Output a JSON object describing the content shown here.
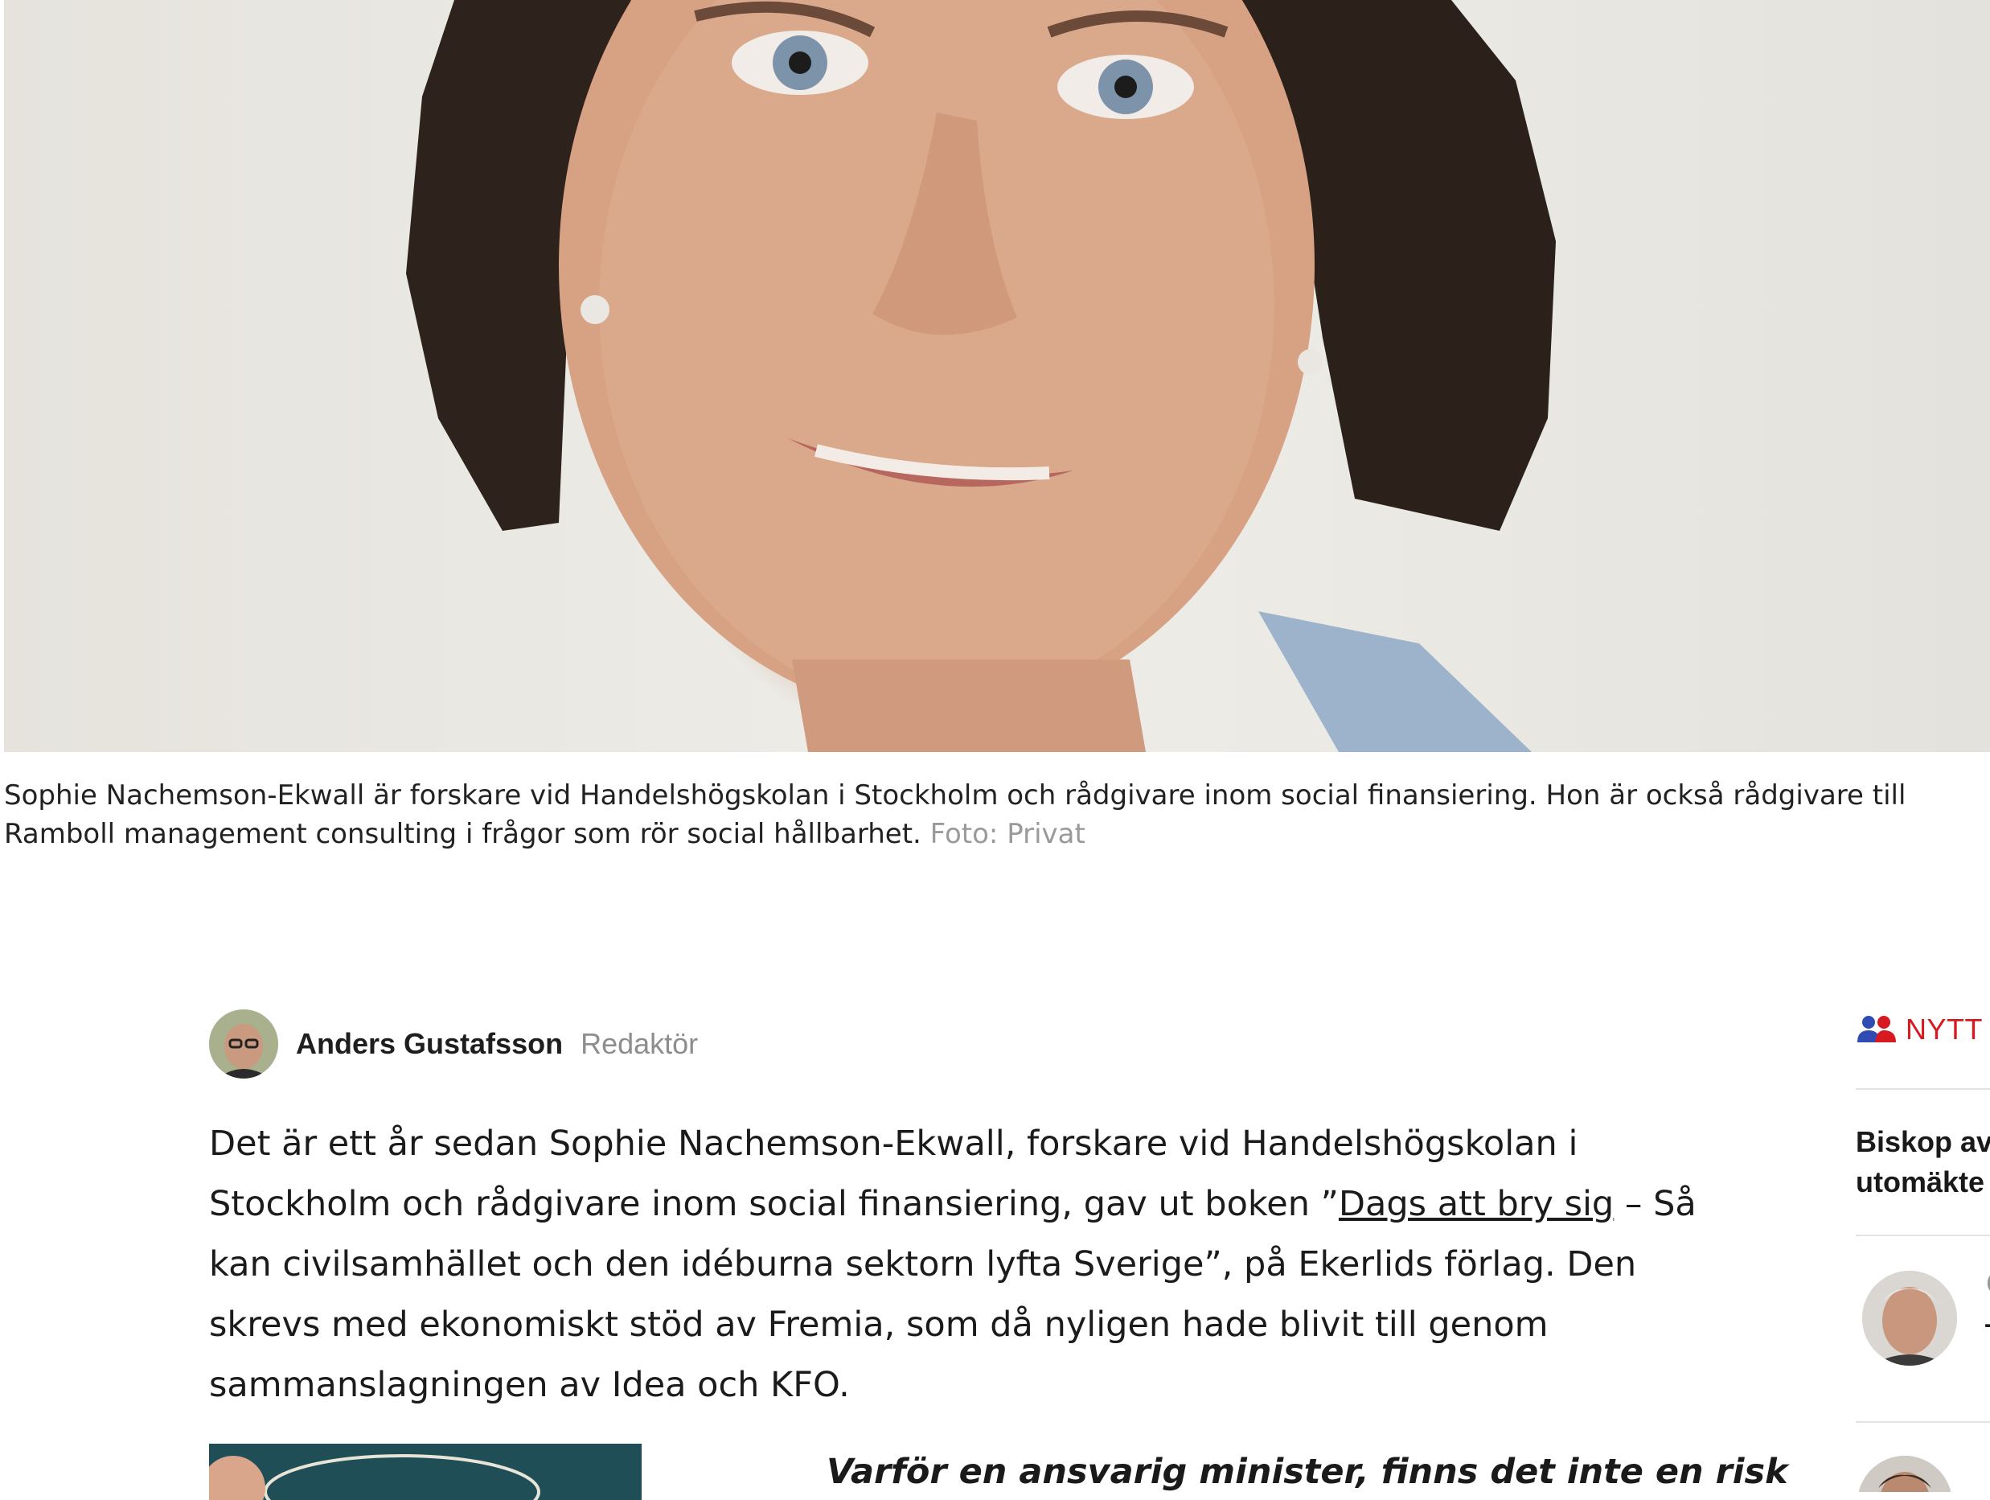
{
  "hero": {
    "alt_subject": "portrait-photo"
  },
  "caption": {
    "text": "Sophie Nachemson-Ekwall är forskare vid Handelshögskolan i Stockholm och rådgivare inom social finansiering. Hon är också rådgivare till Ramboll management consulting i frågor som rör social hållbarhet.",
    "credit": "Foto: Privat"
  },
  "byline": {
    "author": "Anders Gustafsson",
    "role": "Redaktör"
  },
  "article": {
    "p1_before_link": "Det är ett år sedan Sophie Nachemson-Ekwall, forskare vid Handelshögskolan i Stockholm och rådgivare inom social finansiering, gav ut boken ”",
    "p1_link": "Dags att bry sig",
    "p1_after_link": " – Så kan civilsamhället och den idéburna sektorn lyfta Sverige”, på Ekerlids förlag. Den skrevs med ekonomiskt stöd av Fremia, som då nyligen hade blivit till genom sammanslagningen av Idea och KFO.",
    "pullquote": "Varför en ansvarig minister, finns det inte en risk"
  },
  "sidebar": {
    "section_label": "NYTT",
    "headline_line1": "Biskop av",
    "headline_line2": "utomäkte",
    "item1_text": "–",
    "item1_initial": "C"
  },
  "colors": {
    "accent_red": "#d71920",
    "icon_blue": "#2f4bb4",
    "muted_gray": "#8d8d8d"
  },
  "icons": {
    "nytt_icon": "people-icon"
  }
}
